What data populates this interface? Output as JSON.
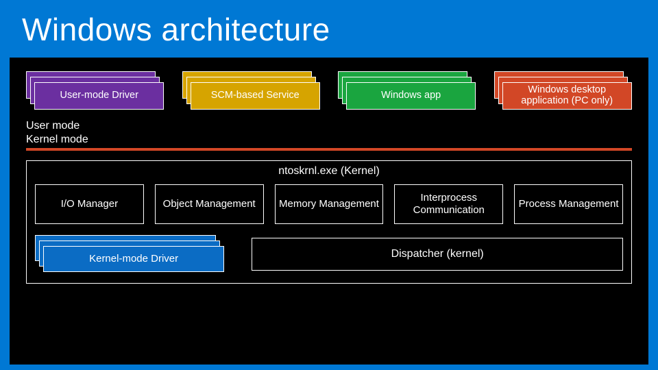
{
  "title": "Windows architecture",
  "top": {
    "umdf": "User-mode Driver",
    "scm": "SCM-based Service",
    "winapp": "Windows app",
    "desktop": "Windows desktop application (PC only)"
  },
  "modes": {
    "user": "User mode",
    "kernel": "Kernel mode"
  },
  "kernel": {
    "heading": "ntoskrnl.exe (Kernel)",
    "io": "I/O Manager",
    "obj": "Object Management",
    "mem": "Memory Management",
    "ipc": "Interprocess Communication",
    "proc": "Process Management",
    "kmdf": "Kernel-mode Driver",
    "disp": "Dispatcher (kernel)"
  }
}
